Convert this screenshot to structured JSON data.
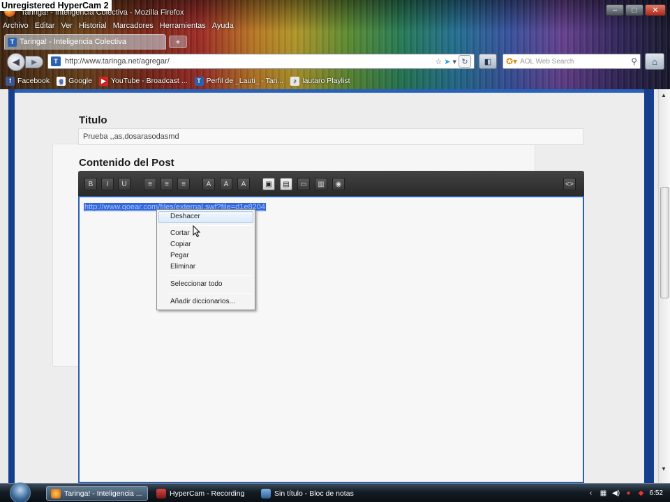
{
  "recorder_label": "Unregistered HyperCam 2",
  "window": {
    "title": "Taringa! - Inteligencia Colectiva - Mozilla Firefox",
    "controls": [
      "–",
      "□",
      "✕"
    ]
  },
  "menu": [
    "Archivo",
    "Editar",
    "Ver",
    "Historial",
    "Marcadores",
    "Herramientas",
    "Ayuda"
  ],
  "tab": {
    "label": "Taringa! - Inteligencia Colectiva",
    "new_tab": "+"
  },
  "navigation": {
    "url": "http://www.taringa.net/agregar/",
    "search_placeholder": "AOL Web Search"
  },
  "bookmarks": [
    {
      "label": "Facebook",
      "icon": "f"
    },
    {
      "label": "Google",
      "icon": "g"
    },
    {
      "label": "YouTube - Broadcast ...",
      "icon": "▶"
    },
    {
      "label": "Perfil de _Lauti_ - Tari...",
      "icon": "T"
    },
    {
      "label": "lautaro Playlist",
      "icon": "♪"
    }
  ],
  "form": {
    "title_label": "Titulo",
    "title_value": "Prueba ,,as,dosarasodasmd",
    "content_label": "Contenido del Post",
    "selected_text": "http://www.goear.com/files/external.swf?file=d1e8204"
  },
  "toolbar": [
    "B",
    "I",
    "U",
    "≡",
    "≡",
    "≡",
    "A",
    "A",
    "A",
    "▣",
    "▤",
    "▭",
    "▥",
    "◉",
    "<>"
  ],
  "context_menu": {
    "undo": "Deshacer",
    "cut": "Cortar",
    "copy": "Copiar",
    "paste": "Pegar",
    "delete": "Eliminar",
    "select_all": "Seleccionar todo",
    "add_dictionaries": "Añadir diccionarios..."
  },
  "taskbar": {
    "tasks": [
      "Taringa! - Inteligencia ...",
      "HyperCam - Recording",
      "Sin título - Bloc de notas"
    ],
    "clock": "6:52"
  }
}
